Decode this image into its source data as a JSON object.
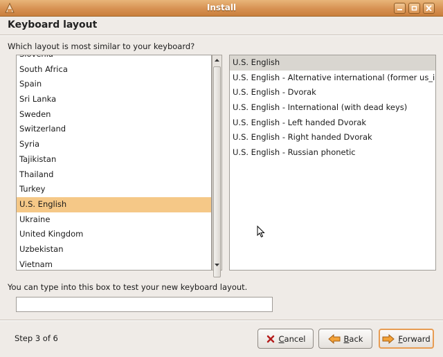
{
  "window": {
    "title": "Install"
  },
  "header": {
    "title": "Keyboard layout"
  },
  "question": "Which layout is most similar to your keyboard?",
  "countries": {
    "partial_top": "Slovenia",
    "items": [
      "South Africa",
      "Spain",
      "Sri Lanka",
      "Sweden",
      "Switzerland",
      "Syria",
      "Tajikistan",
      "Thailand",
      "Turkey",
      "U.S. English",
      "Ukraine",
      "United Kingdom",
      "Uzbekistan",
      "Vietnam"
    ],
    "selected": "U.S. English"
  },
  "variants": {
    "items": [
      "U.S. English",
      "U.S. English - Alternative international (former us_int",
      "U.S. English - Dvorak",
      "U.S. English - International (with dead keys)",
      "U.S. English - Left handed Dvorak",
      "U.S. English - Right handed Dvorak",
      "U.S. English - Russian phonetic"
    ],
    "selected": "U.S. English"
  },
  "test": {
    "hint": "You can type into this box to test your new keyboard layout.",
    "value": ""
  },
  "footer": {
    "step": "Step 3 of 6",
    "cancel_prefix": "",
    "cancel_key": "C",
    "cancel_rest": "ancel",
    "back_prefix": "",
    "back_key": "B",
    "back_rest": "ack",
    "forward_prefix": "",
    "forward_key": "F",
    "forward_rest": "orward"
  },
  "colors": {
    "titlebar": "#d79152",
    "selection": "#f5c887",
    "accent": "#e89c52"
  }
}
